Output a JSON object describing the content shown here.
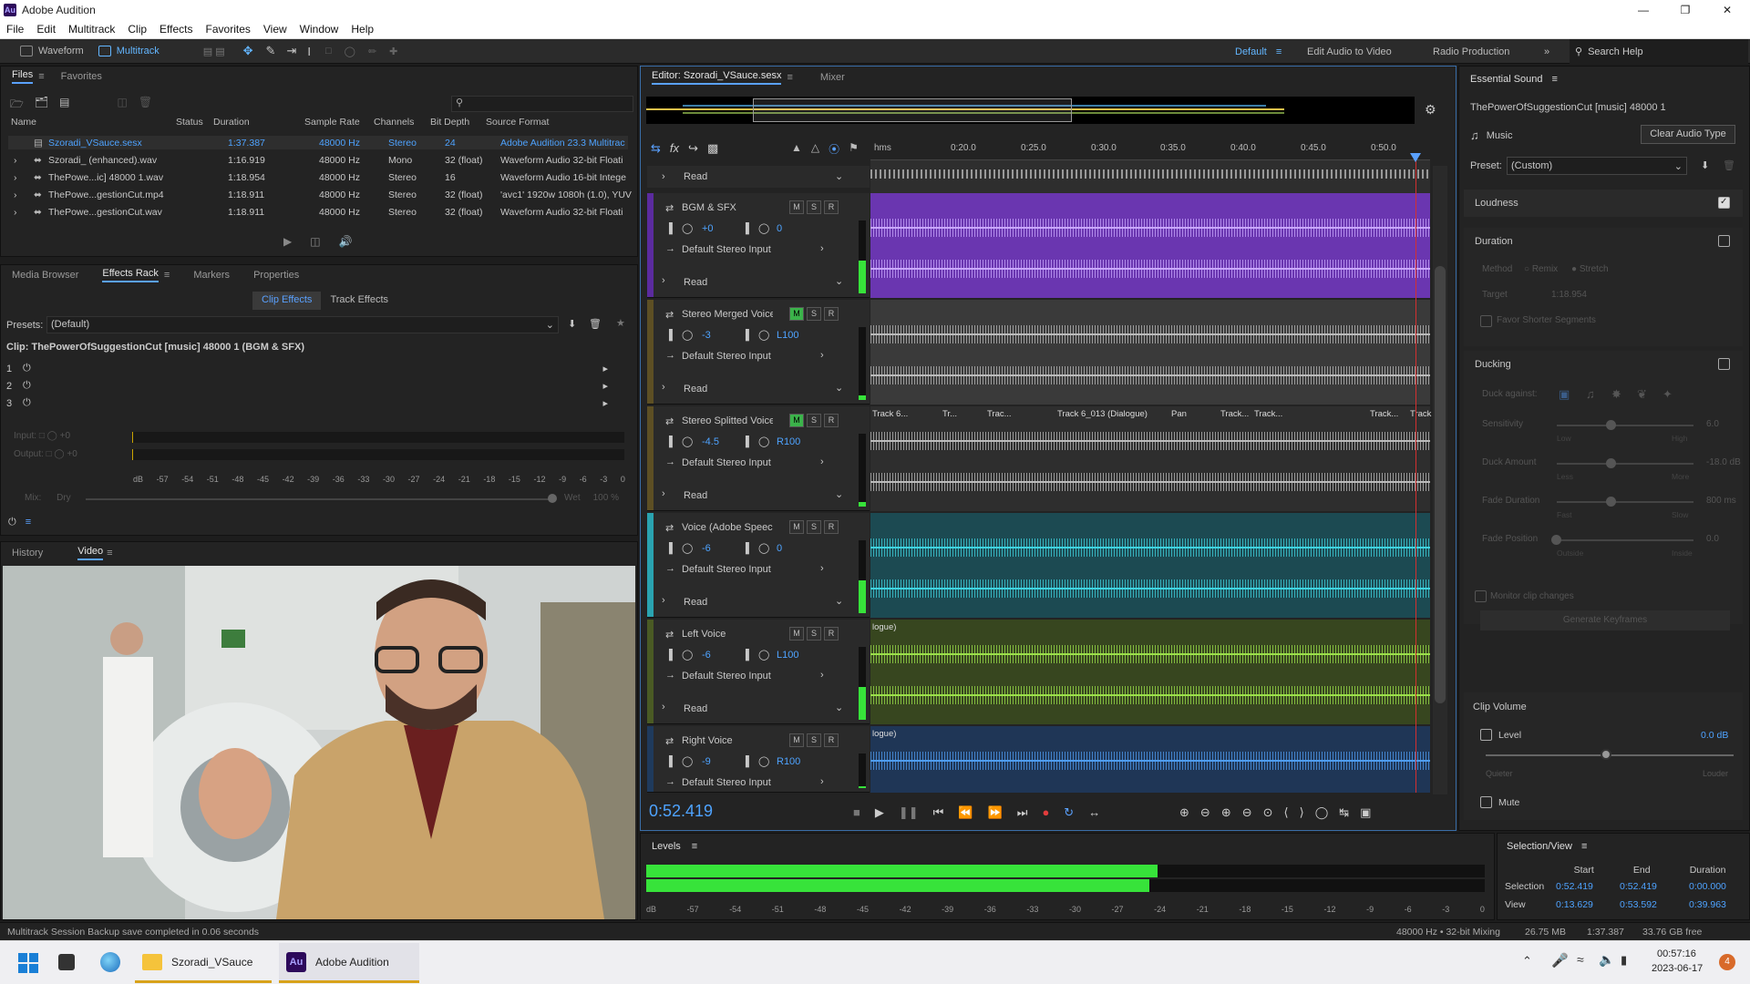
{
  "app": {
    "title": "Adobe Audition"
  },
  "menu": [
    "File",
    "Edit",
    "Multitrack",
    "Clip",
    "Effects",
    "Favorites",
    "View",
    "Window",
    "Help"
  ],
  "toolbar": {
    "waveform": "Waveform",
    "multitrack": "Multitrack",
    "workspaces": [
      "Default",
      "Edit Audio to Video",
      "Radio Production"
    ],
    "search_placeholder": "Search Help"
  },
  "files_panel": {
    "tabs": [
      "Files",
      "Favorites"
    ],
    "columns": [
      "Name",
      "Status",
      "Duration",
      "Sample Rate",
      "Channels",
      "Bit Depth",
      "Source Format"
    ],
    "rows": [
      {
        "name": "Szoradi_VSauce.sesx",
        "duration": "1:37.387",
        "rate": "48000 Hz",
        "channels": "Stereo",
        "bits": "24",
        "format": "Adobe Audition 23.3 Multitrac"
      },
      {
        "name": "Szoradi_ (enhanced).wav",
        "duration": "1:16.919",
        "rate": "48000 Hz",
        "channels": "Mono",
        "bits": "32 (float)",
        "format": "Waveform Audio 32-bit Floati"
      },
      {
        "name": "ThePowe...ic] 48000 1.wav",
        "duration": "1:18.954",
        "rate": "48000 Hz",
        "channels": "Stereo",
        "bits": "16",
        "format": "Waveform Audio 16-bit Intege"
      },
      {
        "name": "ThePowe...gestionCut.mp4",
        "duration": "1:18.911",
        "rate": "48000 Hz",
        "channels": "Stereo",
        "bits": "32 (float)",
        "format": "'avc1' 1920w 1080h (1.0), YUV"
      },
      {
        "name": "ThePowe...gestionCut.wav",
        "duration": "1:18.911",
        "rate": "48000 Hz",
        "channels": "Stereo",
        "bits": "32 (float)",
        "format": "Waveform Audio 32-bit Floati"
      }
    ]
  },
  "effects_panel": {
    "tabs": [
      "Media Browser",
      "Effects Rack",
      "Markers",
      "Properties"
    ],
    "subtabs": [
      "Clip Effects",
      "Track Effects"
    ],
    "presets_label": "Presets:",
    "presets_value": "(Default)",
    "clip_label": "Clip: ThePowerOfSuggestionCut [music] 48000 1 (BGM & SFX)",
    "slots": [
      "1",
      "2",
      "3"
    ],
    "input_label": "Input:",
    "input_value": "+0",
    "output_label": "Output:",
    "output_value": "+0",
    "mix_label": "Mix:",
    "dry": "Dry",
    "wet": "Wet",
    "mix_pct": "100 %",
    "scale": [
      "dB",
      "-57",
      "-54",
      "-51",
      "-48",
      "-45",
      "-42",
      "-39",
      "-36",
      "-33",
      "-30",
      "-27",
      "-24",
      "-21",
      "-18",
      "-15",
      "-12",
      "-9",
      "-6",
      "-3",
      "0"
    ]
  },
  "history_panel": {
    "tabs": [
      "History",
      "Video"
    ]
  },
  "editor": {
    "tabs": [
      "Editor: Szoradi_VSauce.sesx",
      "Mixer"
    ],
    "ruler": [
      "hms",
      "0:20.0",
      "0:25.0",
      "0:30.0",
      "0:35.0",
      "0:40.0",
      "0:45.0",
      "0:50.0"
    ],
    "time": "0:52.419",
    "read": "Read",
    "input": "Default Stereo Input",
    "tracks": [
      {
        "name": "BGM & SFX",
        "vol": "+0",
        "pan": "0",
        "color": "#5b2b9e",
        "clip": "#6a36b0",
        "wave": "#c9a6ff"
      },
      {
        "name": "Stereo Merged Voice",
        "vol": "-3",
        "pan": "L100",
        "color": "#5d4f24",
        "clip": "#3a3a3a",
        "wave": "#bbbbbb"
      },
      {
        "name": "Stereo Splitted Voice",
        "vol": "-4.5",
        "pan": "R100",
        "color": "#5d4f24",
        "clip": "#2e2e2e",
        "wave": "#bbbbbb"
      },
      {
        "name": "Voice (Adobe Speech E",
        "vol": "-6",
        "pan": "0",
        "color": "#2aa3b0",
        "clip": "#1c4a52",
        "wave": "#3fd3e0"
      },
      {
        "name": "Left Voice",
        "vol": "-6",
        "pan": "L100",
        "color": "#4a5a24",
        "clip": "#37461f",
        "wave": "#9be04a"
      },
      {
        "name": "Right Voice",
        "vol": "-9",
        "pan": "R100",
        "color": "#1f3a5c",
        "clip": "#1f3656",
        "wave": "#4e9cf0"
      }
    ],
    "clip_labels": [
      "Track 6...",
      "Tr...",
      "Trac...",
      "Track 6_013 (Dialogue)",
      "Pan",
      "Track...",
      "Track...",
      "Track...",
      "Track"
    ],
    "fragments": [
      "logue)",
      "logue)"
    ]
  },
  "levels": {
    "title": "Levels",
    "scale": [
      "dB",
      "-57",
      "-54",
      "-51",
      "-48",
      "-45",
      "-42",
      "-39",
      "-36",
      "-33",
      "-30",
      "-27",
      "-24",
      "-21",
      "-18",
      "-15",
      "-12",
      "-9",
      "-6",
      "-3",
      "0"
    ],
    "left_level": 0.61,
    "right_level": 0.6
  },
  "selection_view": {
    "title": "Selection/View",
    "headers": [
      "Start",
      "End",
      "Duration"
    ],
    "selection": {
      "label": "Selection",
      "start": "0:52.419",
      "end": "0:52.419",
      "duration": "0:00.000"
    },
    "view": {
      "label": "View",
      "start": "0:13.629",
      "end": "0:53.592",
      "duration": "0:39.963"
    }
  },
  "essential_sound": {
    "title": "Essential Sound",
    "clip": "ThePowerOfSuggestionCut [music] 48000 1",
    "type": "Music",
    "clear": "Clear Audio Type",
    "preset_label": "Preset:",
    "preset": "(Custom)",
    "sections": {
      "loudness": "Loudness",
      "duration": "Duration",
      "method": "Method",
      "remix": "Remix",
      "stretch": "Stretch",
      "target": "Target",
      "target_value": "1:18.954",
      "favor": "Favor Shorter Segments",
      "ducking": "Ducking",
      "duck_against": "Duck against:",
      "sensitivity": "Sensitivity",
      "sens_val": "6.0",
      "low": "Low",
      "high": "High",
      "duck_amount": "Duck Amount",
      "amount_val": "-18.0 dB",
      "less": "Less",
      "more": "More",
      "fade_duration": "Fade Duration",
      "fade_dur_val": "800 ms",
      "fast": "Fast",
      "slow": "Slow",
      "fade_position": "Fade Position",
      "fade_pos_val": "0.0",
      "outside": "Outside",
      "inside": "Inside",
      "monitor": "Monitor clip changes",
      "generate": "Generate Keyframes",
      "clip_volume": "Clip Volume",
      "level": "Level",
      "level_val": "0.0 dB",
      "quieter": "Quieter",
      "louder": "Louder",
      "mute": "Mute"
    }
  },
  "status": {
    "message": "Multitrack Session Backup save completed in 0.06 seconds",
    "format": "48000 Hz • 32-bit Mixing",
    "mem": "26.75 MB",
    "dur": "1:37.387",
    "free": "33.76 GB free"
  },
  "taskbar": {
    "apps": [
      "Szoradi_VSauce",
      "Adobe Audition"
    ],
    "time": "00:57:16",
    "date": "2023-06-17",
    "badge": "4"
  }
}
